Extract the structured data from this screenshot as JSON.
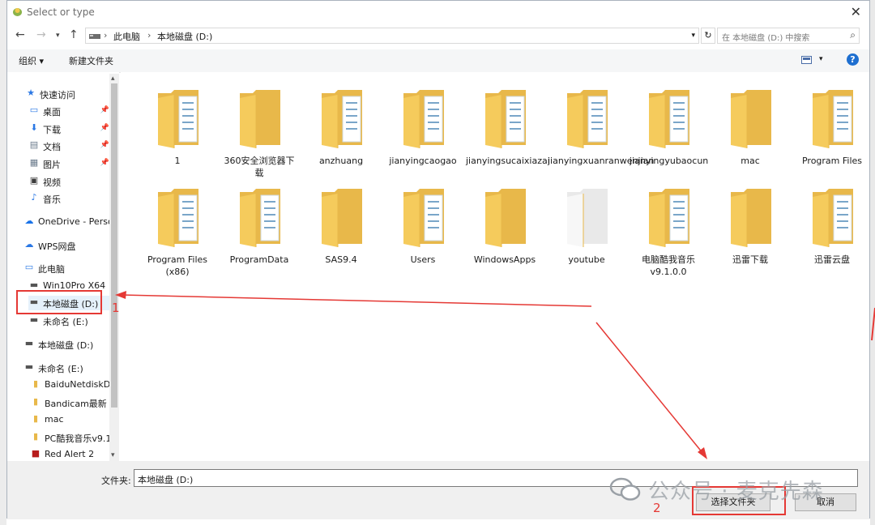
{
  "title": "Select or type",
  "address": {
    "root": "此电脑",
    "current": "本地磁盘 (D:)"
  },
  "search": {
    "placeholder": "在 本地磁盘 (D:) 中搜索"
  },
  "toolbar": {
    "organize": "组织 ▾",
    "new_folder": "新建文件夹"
  },
  "nav": [
    {
      "label": "快速访问",
      "icon": "star-icon",
      "color": "#2b78e4",
      "pinned": false
    },
    {
      "label": "桌面",
      "icon": "desktop-icon",
      "color": "#2b78e4",
      "pinned": true
    },
    {
      "label": "下载",
      "icon": "download-icon",
      "color": "#2b78e4",
      "pinned": true
    },
    {
      "label": "文档",
      "icon": "document-icon",
      "color": "#6b7b8c",
      "pinned": true
    },
    {
      "label": "图片",
      "icon": "pictures-icon",
      "color": "#6b7b8c",
      "pinned": true
    },
    {
      "label": "视频",
      "icon": "video-icon",
      "color": "#3c3c3c",
      "pinned": false
    },
    {
      "label": "音乐",
      "icon": "music-icon",
      "color": "#2b78e4",
      "pinned": false
    },
    {
      "label": "OneDrive - Perso",
      "icon": "cloud-icon",
      "color": "#1a73e8",
      "pinned": false
    },
    {
      "label": "WPS网盘",
      "icon": "cloud-outline-icon",
      "color": "#2b78e4",
      "pinned": false
    },
    {
      "label": "此电脑",
      "icon": "computer-icon",
      "color": "#2b78e4",
      "pinned": false
    },
    {
      "label": "Win10Pro X64",
      "icon": "drive-icon",
      "color": "#555555",
      "pinned": false
    },
    {
      "label": "本地磁盘 (D:)",
      "icon": "drive-icon",
      "color": "#555555",
      "pinned": false
    },
    {
      "label": "未命名 (E:)",
      "icon": "drive-icon",
      "color": "#555555",
      "pinned": false
    },
    {
      "label": "本地磁盘 (D:)",
      "icon": "drive-icon",
      "color": "#555555",
      "pinned": false
    },
    {
      "label": "未命名 (E:)",
      "icon": "drive-icon",
      "color": "#555555",
      "pinned": false
    },
    {
      "label": "BaiduNetdiskD",
      "icon": "folder-icon",
      "color": "#e8b84a",
      "pinned": false
    },
    {
      "label": "Bandicam最新",
      "icon": "folder-icon",
      "color": "#e8b84a",
      "pinned": false
    },
    {
      "label": "mac",
      "icon": "folder-icon",
      "color": "#e8b84a",
      "pinned": false
    },
    {
      "label": "PC酷我音乐v9.1",
      "icon": "folder-icon",
      "color": "#e8b84a",
      "pinned": false
    },
    {
      "label": "Red Alert 2",
      "icon": "app-icon",
      "color": "#b71c1c",
      "pinned": false
    }
  ],
  "folders": [
    {
      "name": "1",
      "kind": "docs"
    },
    {
      "name": "360安全浏览器下载",
      "kind": "plain"
    },
    {
      "name": "anzhuang",
      "kind": "docs"
    },
    {
      "name": "jianyingcaogao",
      "kind": "docs"
    },
    {
      "name": "jianyingsucaixiazai",
      "kind": "docs"
    },
    {
      "name": "jianyingxuanranwenjian",
      "kind": "docs"
    },
    {
      "name": "jianyingyubaocun",
      "kind": "docs"
    },
    {
      "name": "mac",
      "kind": "plain"
    },
    {
      "name": "Program Files",
      "kind": "docs"
    },
    {
      "name": "Program Files (x86)",
      "kind": "docs"
    },
    {
      "name": "ProgramData",
      "kind": "docs"
    },
    {
      "name": "SAS9.4",
      "kind": "plain"
    },
    {
      "name": "Users",
      "kind": "docs"
    },
    {
      "name": "WindowsApps",
      "kind": "plain"
    },
    {
      "name": "youtube",
      "kind": "white"
    },
    {
      "name": "电脑酷我音乐v9.1.0.0",
      "kind": "docs"
    },
    {
      "name": "迅雷下载",
      "kind": "plain"
    },
    {
      "name": "迅雷云盘",
      "kind": "docs"
    }
  ],
  "footer": {
    "folder_label": "文件夹:",
    "folder_value": "本地磁盘 (D:)",
    "select_button": "选择文件夹",
    "cancel_button": "取消"
  },
  "annotations": {
    "step1": "1",
    "step2": "2",
    "watermark": "公众号 · 麦克先森"
  },
  "colors": {
    "folder": "#f5cb5c",
    "folder_dark": "#e8b84a",
    "annotation": "#e53935",
    "help": "#1e6fd0"
  }
}
